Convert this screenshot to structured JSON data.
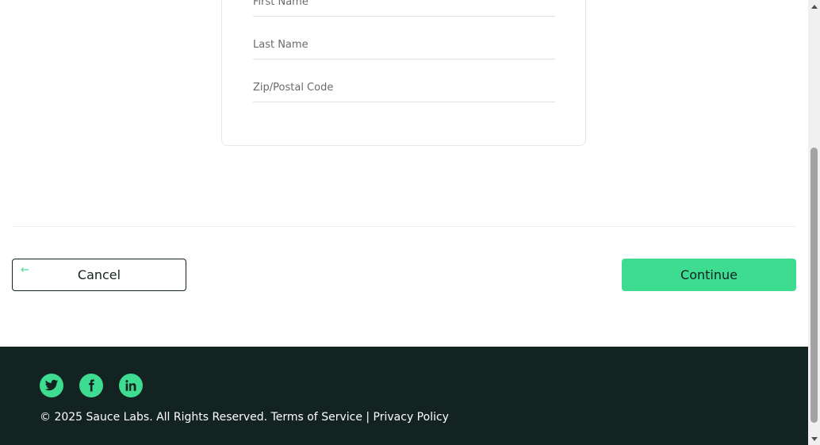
{
  "form": {
    "first_name_placeholder": "First Name",
    "last_name_placeholder": "Last Name",
    "zip_placeholder": "Zip/Postal Code"
  },
  "actions": {
    "cancel_label": "Cancel",
    "cancel_icon": "arrow-left-icon",
    "continue_label": "Continue"
  },
  "footer": {
    "social": [
      "twitter-icon",
      "facebook-icon",
      "linkedin-icon"
    ],
    "copyright": "© 2025 Sauce Labs. All Rights Reserved. Terms of Service | Privacy Policy"
  },
  "colors": {
    "accent": "#3ddc91",
    "footer_bg": "#132322",
    "text": "#132322"
  }
}
